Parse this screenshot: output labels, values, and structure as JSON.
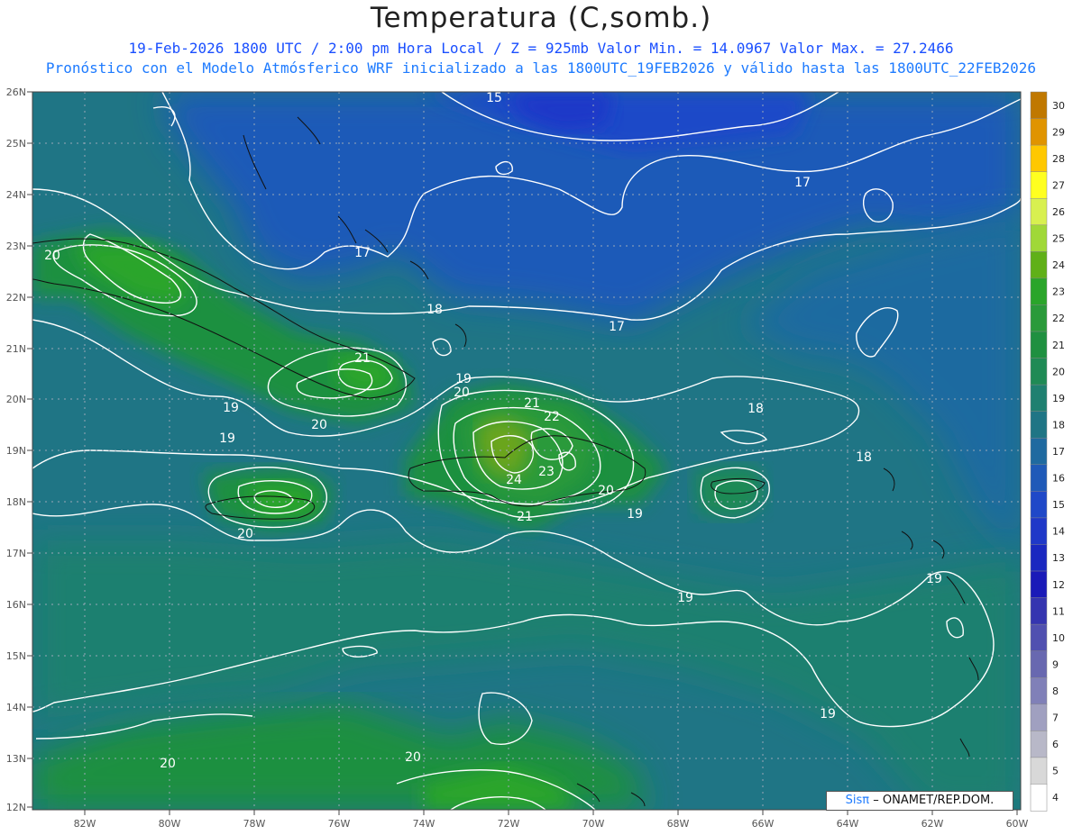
{
  "header": {
    "title": "Temperatura (C,somb.)",
    "line1": "19-Feb-2026  1800 UTC / 2:00 pm Hora Local / Z = 925mb    Valor Min. = 14.0967  Valor Max. = 27.2466",
    "line2": "Pronóstico con el Modelo Atmósferico WRF inicializado a las 1800UTC_19FEB2026 y válido hasta las  1800UTC_22FEB2026"
  },
  "map": {
    "lon_ticks": [
      "82W",
      "80W",
      "78W",
      "76W",
      "74W",
      "72W",
      "70W",
      "68W",
      "66W",
      "64W",
      "62W",
      "60W"
    ],
    "lat_ticks": [
      "26N",
      "25N",
      "24N",
      "23N",
      "22N",
      "21N",
      "20N",
      "19N",
      "18N",
      "17N",
      "16N",
      "15N",
      "14N",
      "13N",
      "12N"
    ],
    "contour_labels": [
      "15",
      "17",
      "17",
      "17",
      "18",
      "18",
      "18",
      "19",
      "19",
      "19",
      "19",
      "19",
      "19",
      "20",
      "20",
      "20",
      "20",
      "20",
      "21",
      "21",
      "21",
      "22",
      "23",
      "24"
    ],
    "colors": {
      "ocean_cool": "#1f4fd0",
      "ocean_mid": "#1f6f9a",
      "land_warm": "#1f9a3a",
      "peak": "#6aa51a"
    }
  },
  "colorbar": {
    "labels": [
      "30",
      "29",
      "28",
      "27",
      "26",
      "25",
      "24",
      "23",
      "22",
      "21",
      "20",
      "19",
      "18",
      "17",
      "16",
      "15",
      "14",
      "13",
      "12",
      "11",
      "10",
      "9",
      "8",
      "7",
      "6",
      "5",
      "4"
    ],
    "colors": [
      "#c07800",
      "#e09400",
      "#ffc800",
      "#ffff20",
      "#d8f050",
      "#a0d838",
      "#60b018",
      "#2aa52a",
      "#2a9a3a",
      "#1f9040",
      "#1f8a55",
      "#1f8070",
      "#1f7585",
      "#1f6aa0",
      "#1f5ab8",
      "#1f48c8",
      "#1f38c8",
      "#1a28c0",
      "#1a1ab8",
      "#3535b0",
      "#5050b0",
      "#6868b0",
      "#8080b8",
      "#a0a0c0",
      "#b8b8c8",
      "#d8d8d8",
      "#ffffff"
    ]
  },
  "credit": {
    "sis": "Sisπ",
    "text": "– ONAMET/REP.DOM."
  }
}
